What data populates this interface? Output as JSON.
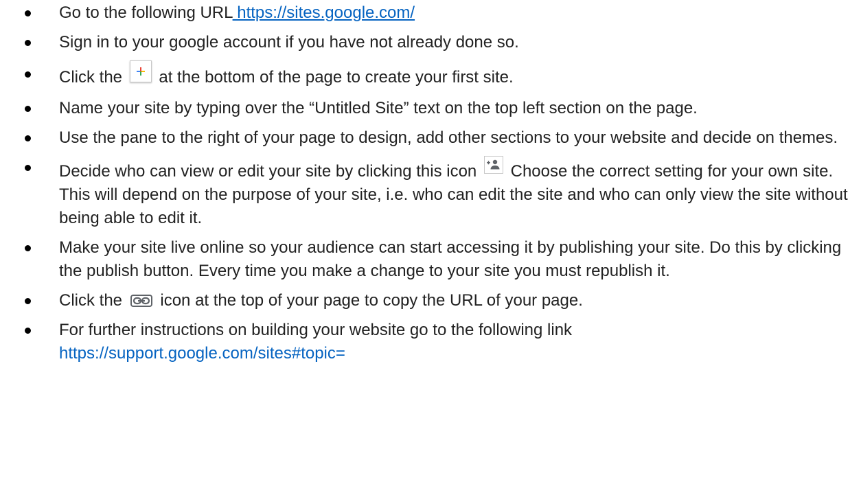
{
  "steps": [
    {
      "before": "Go to the following URL",
      "link": " https://sites.google.com/",
      "after": ""
    },
    {
      "text": "Sign in to your google account if you have not already done so."
    },
    {
      "before": "Click the",
      "icon": "plus-icon",
      "after": "at the bottom of the page to create your first site."
    },
    {
      "text": "Name your site by typing over the “Untitled Site” text on the top left section on the page."
    },
    {
      "text": "Use the pane to the right of your page to design, add other sections to your website and decide on themes."
    },
    {
      "before": "Decide who can view or edit your site by clicking this icon",
      "icon": "share-icon",
      "after": "Choose the correct setting for your own site.  This will depend on the purpose of your site, i.e. who can edit the site and who can only view the site without being able to edit it."
    },
    {
      "text": "Make your site live online so your audience can start accessing it by publishing your site.  Do this by clicking the publish button.  Every time you make a change to your site you must republish it."
    },
    {
      "before": "Click the",
      "icon": "link-icon",
      "after": "icon at the top of your page to copy the URL of your page."
    },
    {
      "before": "For further instructions on building your website go to the following link",
      "link": "https://support.google.com/sites#topic="
    }
  ],
  "colors": {
    "link": "#0563c1",
    "text": "#222222",
    "plus_blue": "#4285f4",
    "plus_red": "#ea4335",
    "plus_yellow": "#fbbc05",
    "plus_green": "#34a853",
    "icon_gray": "#5f6368"
  }
}
